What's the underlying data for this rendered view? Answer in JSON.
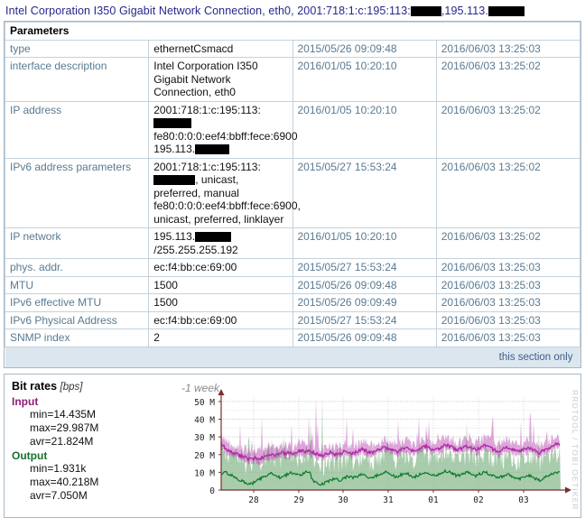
{
  "title": {
    "prefix": "Intel Corporation I350 Gigabit Network Connection, eth0, 2001:718:1:c:195:113:",
    "middle": ",195.113.",
    "suffix": ""
  },
  "parameters": {
    "heading": "Parameters",
    "rows": [
      {
        "key": "type",
        "value": "ethernetCsmacd",
        "created": "2015/05/26 09:09:48",
        "updated": "2016/06/03 13:25:03"
      },
      {
        "key": "interface description",
        "value": "Intel Corporation I350 Gigabit Network Connection, eth0",
        "created": "2016/01/05 10:20:10",
        "updated": "2016/06/03 13:25:02"
      },
      {
        "key": "IP address",
        "value_lines": [
          "2001:718:1:c:195:113:",
          "fe80:0:0:0:eef4:bbff:fece:6900",
          "195.113."
        ],
        "created": "2016/01/05 10:20:10",
        "updated": "2016/06/03 13:25:02"
      },
      {
        "key": "IPv6 address parameters",
        "value_lines": [
          "2001:718:1:c:195:113:",
          ", unicast, preferred, manual",
          "fe80:0:0:0:eef4:bbff:fece:6900, unicast, preferred, linklayer"
        ],
        "created": "2015/05/27 15:53:24",
        "updated": "2016/06/03 13:25:02"
      },
      {
        "key": "IP network",
        "value_prefix": "195.113.",
        "value_suffix": "/255.255.255.192",
        "created": "2016/01/05 10:20:10",
        "updated": "2016/06/03 13:25:02"
      },
      {
        "key": "phys. addr.",
        "value": "ec:f4:bb:ce:69:00",
        "created": "2015/05/27 15:53:24",
        "updated": "2016/06/03 13:25:03"
      },
      {
        "key": "MTU",
        "value": "1500",
        "created": "2015/05/26 09:09:48",
        "updated": "2016/06/03 13:25:03"
      },
      {
        "key": "IPv6 effective MTU",
        "value": "1500",
        "created": "2015/05/26 09:09:49",
        "updated": "2016/06/03 13:25:03"
      },
      {
        "key": "IPv6 Physical Address",
        "value": "ec:f4:bb:ce:69:00",
        "created": "2015/05/27 15:53:24",
        "updated": "2016/06/03 13:25:03"
      },
      {
        "key": "SNMP index",
        "value": "2",
        "created": "2015/05/26 09:09:48",
        "updated": "2016/06/03 13:25:03"
      }
    ],
    "footer_link": "this section only"
  },
  "bitrates": {
    "title": "Bit rates",
    "unit": "[bps]",
    "input": {
      "label": "Input",
      "color": "#b02ba8",
      "min": "min=14.435M",
      "max": "max=29.987M",
      "avr": "avr=21.824M"
    },
    "output": {
      "label": "Output",
      "color": "#0a7a28",
      "min": "min=1.931k",
      "max": "max=40.218M",
      "avr": "avr=7.050M"
    },
    "range_label": "-1 week",
    "watermark": "RRDTOOL / TOBI OETIKER"
  },
  "chart_data": {
    "type": "line",
    "title": "Bit rates [bps]",
    "subtitle": "-1 week",
    "ylabel": "bps",
    "xlabel": "",
    "ylim": [
      0,
      52000000
    ],
    "ytick_labels": [
      "0",
      "10 M",
      "20 M",
      "30 M",
      "40 M",
      "50 M"
    ],
    "ytick_values": [
      0,
      10000000,
      20000000,
      30000000,
      40000000,
      50000000
    ],
    "xtick_labels": [
      "28",
      "29",
      "30",
      "31",
      "01",
      "02",
      "03"
    ],
    "grid": true,
    "legend": [
      "Input",
      "Output"
    ],
    "series": [
      {
        "name": "Input",
        "color": "#b02ba8",
        "min": 14435000,
        "max": 29987000,
        "avg": 21824000,
        "values": [
          25.8,
          24.9,
          23.4,
          22.6,
          21.8,
          21.2,
          20.6,
          20.1,
          19.6,
          19.2,
          18.6,
          18.1,
          17.6,
          17.2,
          17.8,
          18.4,
          18.0,
          17.5,
          18.2,
          19.0,
          19.6,
          20.1,
          19.8,
          19.4,
          19.9,
          20.6,
          21.2,
          20.8,
          20.3,
          20.9,
          21.5,
          21.0,
          20.5,
          21.1,
          21.8,
          22.4,
          21.9,
          21.4,
          22.0,
          22.6,
          21.7,
          21.0,
          20.4,
          19.9,
          19.5,
          19.8,
          20.3,
          20.8,
          21.2,
          20.7,
          20.2,
          19.8,
          20.4,
          21.0,
          21.6,
          22.2,
          21.7,
          21.1,
          20.6,
          21.2,
          21.8,
          22.4,
          23.0,
          22.5,
          21.9,
          21.3,
          20.8,
          21.4,
          22.0,
          22.6,
          23.2,
          23.8,
          24.4,
          23.9,
          23.3,
          22.7,
          22.1,
          21.6,
          22.2,
          22.8,
          23.4,
          24.0,
          23.5,
          22.9,
          22.3,
          21.8,
          22.4,
          23.0,
          23.6,
          24.2,
          24.8,
          24.2,
          23.6,
          23.0,
          22.5,
          23.1,
          23.7,
          24.3,
          24.9,
          25.5,
          24.9,
          24.3,
          23.7,
          23.1,
          22.6,
          23.2,
          23.8,
          24.4,
          25.0,
          24.4,
          23.8,
          23.2,
          22.7,
          23.3,
          23.9,
          24.5,
          25.1,
          24.5,
          23.9,
          23.3,
          22.8,
          22.3,
          21.8,
          22.4,
          23.0,
          23.6,
          24.2,
          23.6,
          23.0,
          22.5,
          22.0,
          21.5,
          22.1,
          22.7,
          23.3,
          23.9,
          23.3,
          22.7,
          22.2,
          21.7,
          21.2,
          21.8,
          22.4,
          23.0,
          23.6,
          24.2,
          24.8,
          25.4,
          26.0,
          25.4
        ]
      },
      {
        "name": "Output",
        "color": "#0a7a28",
        "min": 1931,
        "max": 40218000,
        "avg": 7050000,
        "values": [
          8.5,
          9.2,
          10.1,
          9.4,
          8.6,
          7.9,
          7.2,
          6.5,
          5.8,
          5.2,
          4.6,
          4.1,
          3.7,
          3.3,
          4.0,
          4.8,
          5.5,
          6.2,
          6.9,
          7.5,
          8.1,
          8.7,
          9.3,
          8.7,
          8.1,
          7.5,
          6.9,
          7.5,
          8.1,
          8.7,
          9.3,
          9.9,
          9.3,
          8.7,
          8.1,
          8.7,
          9.3,
          9.9,
          10.5,
          9.9,
          6.2,
          5.0,
          4.2,
          3.6,
          3.1,
          3.7,
          4.3,
          4.9,
          5.5,
          6.1,
          6.7,
          6.1,
          5.5,
          6.1,
          6.7,
          7.3,
          7.9,
          7.3,
          6.7,
          7.3,
          7.9,
          8.5,
          9.1,
          8.5,
          7.9,
          7.3,
          6.7,
          7.3,
          7.9,
          8.5,
          9.1,
          9.7,
          10.3,
          9.7,
          9.1,
          8.5,
          7.9,
          7.3,
          7.9,
          8.5,
          9.1,
          9.7,
          9.1,
          8.5,
          7.9,
          7.3,
          7.9,
          8.5,
          9.1,
          9.7,
          10.3,
          9.7,
          9.1,
          8.5,
          7.9,
          8.5,
          9.1,
          9.7,
          10.3,
          10.9,
          10.3,
          9.7,
          9.1,
          8.5,
          7.9,
          8.5,
          9.1,
          9.7,
          10.3,
          9.7,
          9.1,
          8.5,
          7.9,
          8.5,
          9.1,
          9.7,
          10.3,
          9.7,
          9.1,
          8.5,
          7.9,
          7.3,
          6.7,
          7.3,
          7.9,
          8.5,
          9.1,
          8.5,
          7.9,
          7.3,
          6.7,
          6.1,
          6.7,
          7.3,
          7.9,
          8.5,
          7.9,
          7.3,
          6.7,
          6.1,
          5.5,
          6.1,
          6.7,
          7.3,
          7.9,
          8.5,
          9.1,
          9.7,
          10.3,
          9.7
        ]
      }
    ]
  }
}
